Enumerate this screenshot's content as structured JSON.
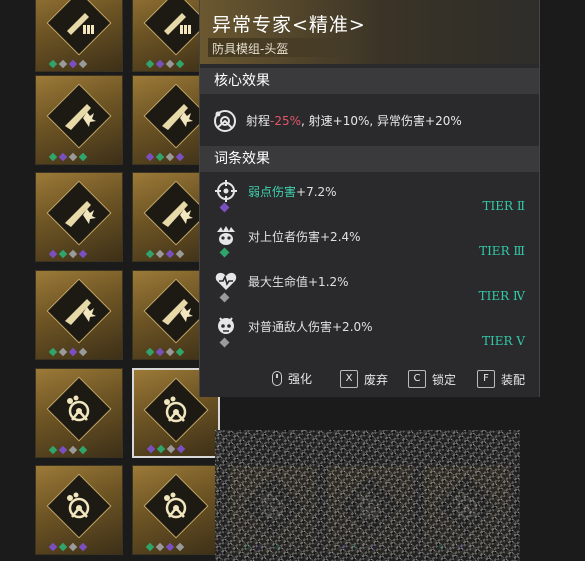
{
  "tooltip": {
    "title": "异常专家<精准>",
    "subtitle": "防具模组-头盔",
    "core_section": "核心效果",
    "core_effect": {
      "icon": "anomaly-expert-icon",
      "prefix": "射程",
      "negative": "-25%",
      "rest": ", 射速+10%, 异常伤害+20%"
    },
    "affix_section": "词条效果",
    "affixes": [
      {
        "icon": "crosshair-icon",
        "highlight": "弱点伤害",
        "rest": "+7.2%",
        "tier": "TIER Ⅱ",
        "gem": "#7a4fc0"
      },
      {
        "icon": "elite-skull-icon",
        "highlight": "",
        "rest": "对上位者伤害+2.4%",
        "tier": "TIER Ⅲ",
        "gem": "#2fa56b"
      },
      {
        "icon": "heart-pulse-icon",
        "highlight": "",
        "rest": "最大生命值+1.2%",
        "tier": "TIER Ⅳ",
        "gem": "#9a9a9a"
      },
      {
        "icon": "minion-skull-icon",
        "highlight": "",
        "rest": "对普通敌人伤害+2.0%",
        "tier": "TIER Ⅴ",
        "gem": "#9a9a9a"
      }
    ],
    "actions": [
      {
        "key": "mouse-icon",
        "label": "强化"
      },
      {
        "key": "X",
        "label": "废弃"
      },
      {
        "key": "C",
        "label": "锁定"
      },
      {
        "key": "F",
        "label": "装配"
      }
    ]
  },
  "colors": {
    "negative": "#e0566a",
    "highlight": "#3fd1b0",
    "tier": "#33c9a8"
  }
}
